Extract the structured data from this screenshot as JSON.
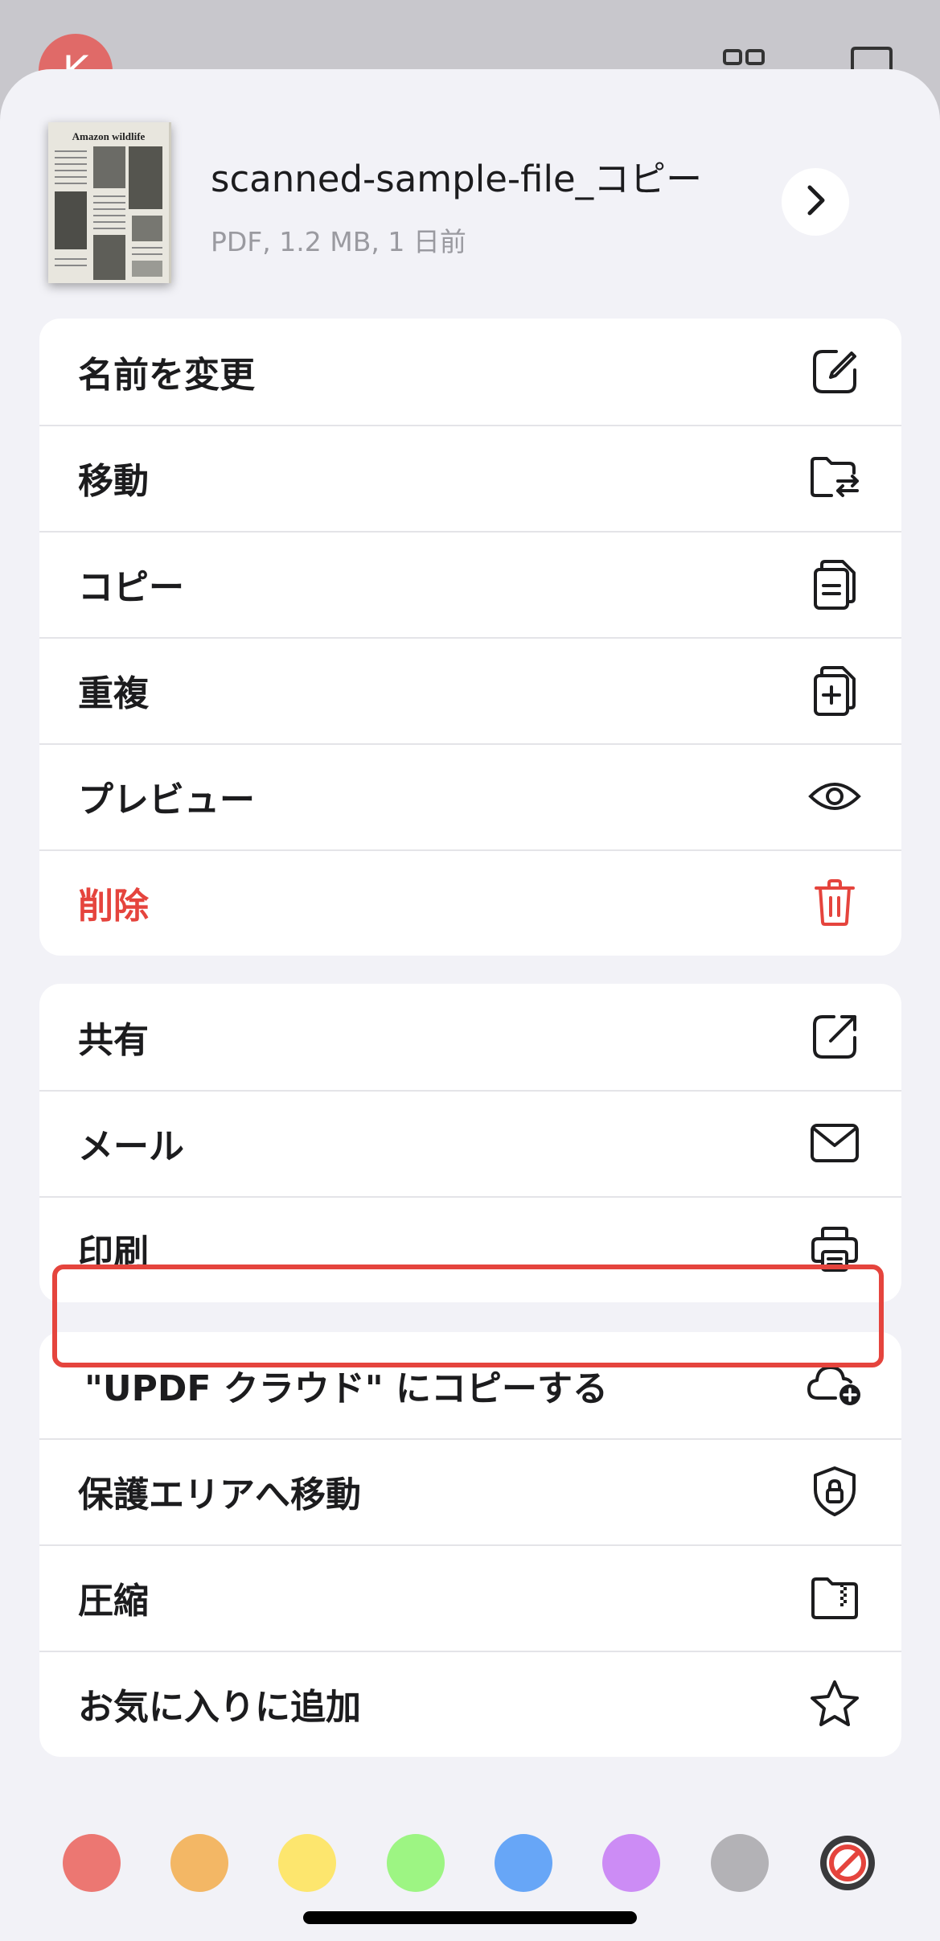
{
  "background": {
    "avatar_letter": "K"
  },
  "file": {
    "thumbnail_title": "Amazon wildlife",
    "name": "scanned-sample-file_コピー",
    "meta": "PDF, 1.2 MB, 1 日前"
  },
  "groups": [
    {
      "items": [
        {
          "label": "名前を変更",
          "icon": "rename-icon"
        },
        {
          "label": "移動",
          "icon": "move-folder-icon"
        },
        {
          "label": "コピー",
          "icon": "copy-icon"
        },
        {
          "label": "重複",
          "icon": "duplicate-icon"
        },
        {
          "label": "プレビュー",
          "icon": "eye-icon"
        },
        {
          "label": "削除",
          "icon": "trash-icon",
          "destructive": true
        }
      ]
    },
    {
      "items": [
        {
          "label": "共有",
          "icon": "share-icon"
        },
        {
          "label": "メール",
          "icon": "mail-icon"
        },
        {
          "label": "印刷",
          "icon": "printer-icon",
          "highlighted": true
        }
      ]
    },
    {
      "items": [
        {
          "label": "\"UPDF クラウド\" にコピーする",
          "icon": "cloud-add-icon"
        },
        {
          "label": "保護エリアへ移動",
          "icon": "shield-lock-icon"
        },
        {
          "label": "圧縮",
          "icon": "zip-folder-icon"
        },
        {
          "label": "お気に入りに追加",
          "icon": "star-icon"
        }
      ]
    }
  ],
  "colors": {
    "accent_red": "#e5443d",
    "tags": [
      "#ec7772",
      "#f3b765",
      "#fde66e",
      "#9df583",
      "#67a6f7",
      "#cc8cf5",
      "#b3b2b6"
    ],
    "clear_tag_icon": "no-color-icon"
  }
}
